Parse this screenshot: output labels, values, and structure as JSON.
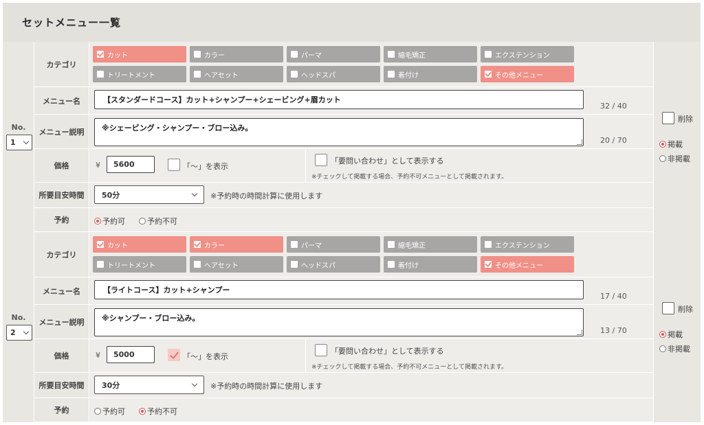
{
  "page": {
    "title": "セットメニュー一覧"
  },
  "labels": {
    "category": "カテゴリ",
    "menu_name": "メニュー名",
    "menu_desc": "メニュー説明",
    "price": "価格",
    "duration": "所要目安時間",
    "reservation": "予約",
    "no": "No.",
    "yen": "¥",
    "tilde_display": "「〜」を表示",
    "inquiry_display": "「要問い合わせ」として表示する",
    "inquiry_note": "※チェックして掲載する場合、予約不可メニューとして掲載されます。",
    "duration_note": "※予約時の時間計算に使用します",
    "reservable": "予約可",
    "not_reservable": "予約不可",
    "delete": "削除",
    "published": "掲載",
    "unpublished": "非掲載"
  },
  "categories": [
    "カット",
    "カラー",
    "パーマ",
    "縮毛矯正",
    "エクステンション",
    "トリートメント",
    "ヘアセット",
    "ヘッドスパ",
    "着付け",
    "その他メニュー"
  ],
  "entries": [
    {
      "no": "1",
      "selected_categories": [
        "カット",
        "その他メニュー"
      ],
      "menu_name": "【スタンダードコース】カット+シャンプー+シェービング+眉カット",
      "menu_name_count": "32 / 40",
      "menu_desc": "※シェービング・シャンプー・ブロー込み。",
      "menu_desc_count": "20 / 70",
      "price": "5600",
      "tilde_checked": false,
      "inquiry_checked": false,
      "duration": "50分",
      "reservable": true,
      "published": true
    },
    {
      "no": "2",
      "selected_categories": [
        "カット",
        "カラー",
        "その他メニュー"
      ],
      "menu_name": "【ライトコース】カット+シャンプー",
      "menu_name_count": "17 / 40",
      "menu_desc": "※シャンプー・ブロー込み。",
      "menu_desc_count": "13 / 70",
      "price": "5000",
      "tilde_checked": true,
      "inquiry_checked": false,
      "duration": "30分",
      "reservable": false,
      "published": true
    }
  ],
  "colors": {
    "category_on": "#f19087",
    "category_off": "#a7a6a5",
    "radio_selected": "#d9534f"
  }
}
